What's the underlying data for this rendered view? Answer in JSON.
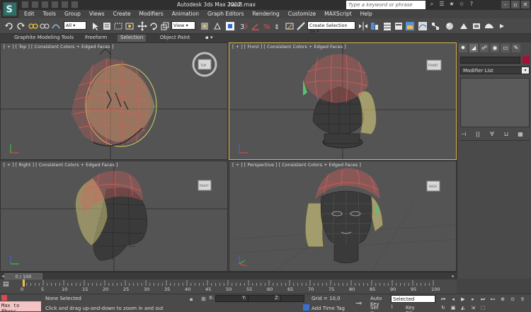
{
  "window": {
    "app_title": "Autodesk 3ds Max  2012",
    "file_name": "hair8.max",
    "search_placeholder": "Type a keyword or phrase",
    "win_buttons": [
      "–",
      "▫",
      "✕"
    ]
  },
  "menu": [
    "Edit",
    "Tools",
    "Group",
    "Views",
    "Create",
    "Modifiers",
    "Animation",
    "Graph Editors",
    "Rendering",
    "Customize",
    "MAXScript",
    "Help"
  ],
  "toolbar": {
    "filter_select": "All",
    "refcoord_select": "View",
    "selection_set": "Create Selection Se"
  },
  "ribbon": {
    "tabs": [
      "Graphite Modeling Tools",
      "Freeform",
      "Selection",
      "Object Paint"
    ],
    "active": "Selection"
  },
  "viewports": [
    {
      "label": "[ + ] [ Top ] [ Consistent Colors + Edged Faces ]",
      "cube": "TOP"
    },
    {
      "label": "[ + ] [ Front ] [ Consistent Colors + Edged Faces ]",
      "cube": "FRONT"
    },
    {
      "label": "[ + ] [ Right ] [ Consistent Colors + Edged Faces ]",
      "cube": "RIGHT"
    },
    {
      "label": "[ + ] [ Perspective ] [ Consistent Colors + Edged Faces ]",
      "cube": "BACK"
    }
  ],
  "command_panel": {
    "modifier_list": "Modifier List",
    "object_color": "#a0123a"
  },
  "timeline": {
    "slider_label": "0 / 100",
    "ticks": [
      "0",
      "5",
      "10",
      "15",
      "20",
      "25",
      "30",
      "35",
      "40",
      "45",
      "50",
      "55",
      "60",
      "65",
      "70",
      "75",
      "80",
      "85",
      "90",
      "95",
      "100"
    ]
  },
  "status": {
    "maxscript": "Max to Physc.",
    "selection": "None Selected",
    "prompt": "Click and drag up-and-down to zoom in and out",
    "x_label": "X:",
    "y_label": "Y:",
    "z_label": "Z:",
    "grid": "Grid = 10,0",
    "add_time_tag": "Add Time Tag",
    "auto_key": "Auto Key",
    "set_key": "Set Key",
    "auto_key_select": "Selected",
    "key_filters": "Key Filters..."
  },
  "colors": {
    "hair_red": "#d9605a",
    "hair_yellow": "#d8d060",
    "mesh_dark": "#2a2a2a",
    "viewport_bg": "#545454",
    "active_border": "#d6b24a"
  }
}
